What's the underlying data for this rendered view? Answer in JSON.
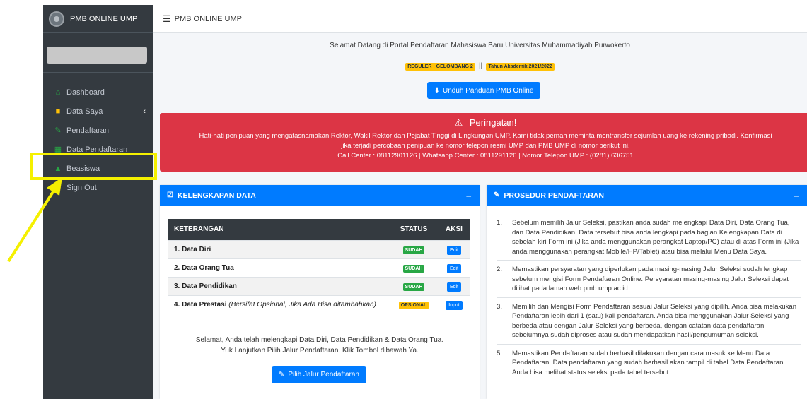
{
  "sidebar": {
    "brand": "PMB ONLINE UMP",
    "items": [
      {
        "label": "Dashboard",
        "icon": "home-icon"
      },
      {
        "label": "Data Saya",
        "icon": "folder-icon"
      },
      {
        "label": "Pendaftaran",
        "icon": "edit-icon"
      },
      {
        "label": "Data Pendaftaran",
        "icon": "table-icon"
      },
      {
        "label": "Beasiswa",
        "icon": "graduation-cap-icon"
      },
      {
        "label": "Sign Out",
        "icon": "sign-out-icon"
      }
    ]
  },
  "topbar": {
    "title": "PMB ONLINE UMP"
  },
  "welcome": {
    "text": "Selamat Datang di Portal Pendaftaran Mahasiswa Baru Universitas Muhammadiyah Purwokerto",
    "badge1": "REGULER : GELOMBANG 2",
    "separator": "||",
    "badge2": "Tahun Akademik 2021/2022",
    "download_label": "Unduh Panduan PMB Online"
  },
  "alert": {
    "title": "Peringatan!",
    "line1": "Hati-hati penipuan yang mengatasnamakan Rektor, Wakil Rektor dan Pejabat Tinggi di Lingkungan UMP. Kami tidak pernah meminta mentransfer sejumlah uang ke rekening pribadi. Konfirmasi",
    "line2": "jika terjadi percobaan penipuan ke nomor telepon resmi UMP dan PMB UMP di nomor berikut ini.",
    "line3": "Call Center : 08112901126 | Whatsapp Center : 0811291126 | Nomor Telepon UMP : (0281) 636751"
  },
  "kelengkapan": {
    "title": "KELENGKAPAN DATA",
    "headers": {
      "keterangan": "KETERANGAN",
      "status": "STATUS",
      "aksi": "AKSI"
    },
    "rows": [
      {
        "label": "1. Data Diri",
        "status": "SUDAH",
        "aksi": "Edit"
      },
      {
        "label": "2. Data Orang Tua",
        "status": "SUDAH",
        "aksi": "Edit"
      },
      {
        "label": "3. Data Pendidikan",
        "status": "SUDAH",
        "aksi": "Edit"
      },
      {
        "label": "4. Data Prestasi",
        "note": "(Bersifat Opsional, Jika Ada Bisa ditambahkan)",
        "status": "OPSIONAL",
        "aksi": "Input"
      }
    ],
    "done_line1": "Selamat, Anda telah melengkapi Data Diri, Data Pendidikan & Data Orang Tua.",
    "done_line2": "Yuk Lanjutkan Pilih Jalur Pendaftaran. Klik Tombol dibawah Ya.",
    "button": "Pilih Jalur Pendaftaran"
  },
  "prosedur": {
    "title": "PROSEDUR PENDAFTARAN",
    "items": [
      {
        "num": "1.",
        "text": "Sebelum memilih Jalur Seleksi, pastikan anda sudah melengkapi Data Diri, Data Orang Tua, dan Data Pendidikan. Data tersebut bisa anda lengkapi pada bagian Kelengkapan Data di sebelah kiri Form ini (Jika anda menggunakan perangkat Laptop/PC) atau di atas Form ini (Jika anda menggunakan perangkat Mobile/HP/Tablet) atau bisa melalui Menu Data Saya."
      },
      {
        "num": "2.",
        "text": "Memastikan persyaratan yang diperlukan pada masing-masing Jalur Seleksi sudah lengkap sebelum mengisi Form Pendaftaran Online. Persyaratan masing-masing Jalur Seleksi dapat dilihat pada laman web pmb.ump.ac.id"
      },
      {
        "num": "3.",
        "text": "Memilih dan Mengisi Form Pendaftaran sesuai Jalur Seleksi yang dipilih. Anda bisa melakukan Pendaftaran lebih dari 1 (satu) kali pendaftaran. Anda bisa menggunakan Jalur Seleksi yang berbeda atau dengan Jalur Seleksi yang berbeda, dengan catatan data pendaftaran sebelumnya sudah diproses atau sudah mendapatkan hasil/pengumuman seleksi."
      },
      {
        "num": "5.",
        "text": "Memastikan Pendaftaran sudah berhasil dilakukan dengan cara masuk ke Menu Data Pendaftaran. Data pendaftaran yang sudah berhasil akan tampil di tabel Data Pendaftaran. Anda bisa melihat status seleksi pada tabel tersebut."
      }
    ]
  },
  "colors": {
    "primary": "#007bff",
    "danger": "#dc3545",
    "sidebar": "#343a40",
    "highlight": "#f5f000"
  }
}
